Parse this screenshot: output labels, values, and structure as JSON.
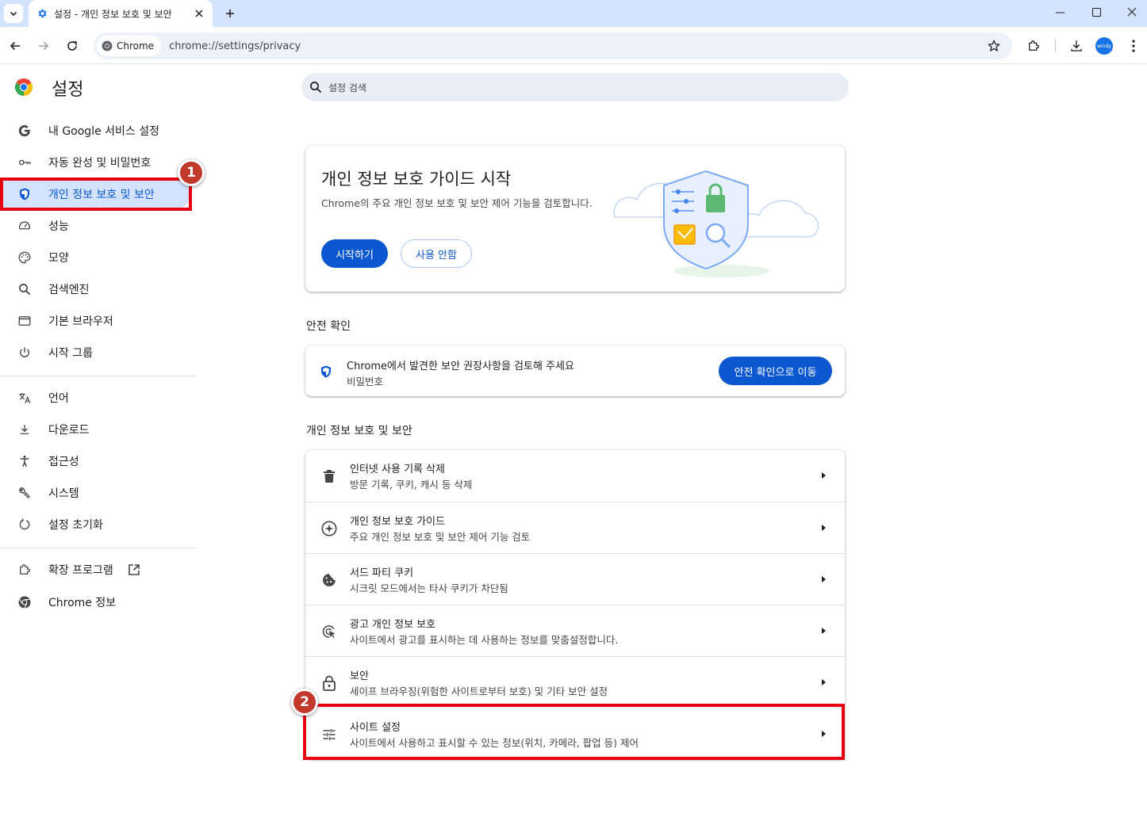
{
  "tab": {
    "title": "설정 - 개인 정보 보호 및 보안"
  },
  "omnibox": {
    "chip_label": "Chrome",
    "url": "chrome://settings/privacy"
  },
  "profile": {
    "label": "windy"
  },
  "header": {
    "title": "설정",
    "search_placeholder": "설정 검색"
  },
  "sidebar": {
    "items": [
      {
        "label": "내 Google 서비스 설정",
        "icon": "google-g-icon"
      },
      {
        "label": "자동 완성 및 비밀번호",
        "icon": "key-icon"
      },
      {
        "label": "개인 정보 보호 및 보안",
        "icon": "shield-icon",
        "active": true
      },
      {
        "label": "성능",
        "icon": "speedometer-icon"
      },
      {
        "label": "모양",
        "icon": "palette-icon"
      },
      {
        "label": "검색엔진",
        "icon": "search-icon"
      },
      {
        "label": "기본 브라우저",
        "icon": "browser-window-icon"
      },
      {
        "label": "시작 그룹",
        "icon": "power-icon"
      },
      {
        "label": "언어",
        "icon": "translate-icon"
      },
      {
        "label": "다운로드",
        "icon": "download-icon"
      },
      {
        "label": "접근성",
        "icon": "accessibility-icon"
      },
      {
        "label": "시스템",
        "icon": "wrench-icon"
      },
      {
        "label": "설정 초기화",
        "icon": "reset-icon"
      },
      {
        "label": "확장 프로그램",
        "icon": "puzzle-icon"
      },
      {
        "label": "Chrome 정보",
        "icon": "chrome-icon"
      }
    ]
  },
  "guide_card": {
    "title": "개인 정보 보호 가이드 시작",
    "description": "Chrome의 주요 개인 정보 보호 및 보안 제어 기능을 검토합니다.",
    "start_button": "시작하기",
    "dismiss_button": "사용 안함"
  },
  "safety_check": {
    "heading": "안전 확인",
    "title": "Chrome에서 발견한 보안 권장사항을 검토해 주세요",
    "subtitle": "비밀번호",
    "button": "안전 확인으로 이동"
  },
  "privacy_section": {
    "heading": "개인 정보 보호 및 보안",
    "rows": [
      {
        "title": "인터넷 사용 기록 삭제",
        "subtitle": "방문 기록, 쿠키, 캐시 등 삭제",
        "icon": "trash-icon"
      },
      {
        "title": "개인 정보 보호 가이드",
        "subtitle": "주요 개인 정보 보호 및 보안 제어 기능 검토",
        "icon": "compass-icon"
      },
      {
        "title": "서드 파티 쿠키",
        "subtitle": "시크릿 모드에서는 타사 쿠키가 차단됨",
        "icon": "cookie-icon"
      },
      {
        "title": "광고 개인 정보 보호",
        "subtitle": "사이트에서 광고를 표시하는 데 사용하는 정보를 맞춤설정합니다.",
        "icon": "ads-privacy-icon"
      },
      {
        "title": "보안",
        "subtitle": "세이프 브라우징(위험한 사이트로부터 보호) 및 기타 보안 설정",
        "icon": "lock-icon"
      },
      {
        "title": "사이트 설정",
        "subtitle": "사이트에서 사용하고 표시할 수 있는 정보(위치, 카메라, 팝업 등) 제어",
        "icon": "tune-icon"
      }
    ]
  },
  "annotations": {
    "badge1": "1",
    "badge2": "2",
    "highlight_color": "#e60012"
  },
  "colors": {
    "accent": "#0b57d0",
    "active_nav_bg": "#d3e3fd",
    "titlebar": "#d3e3fd"
  }
}
